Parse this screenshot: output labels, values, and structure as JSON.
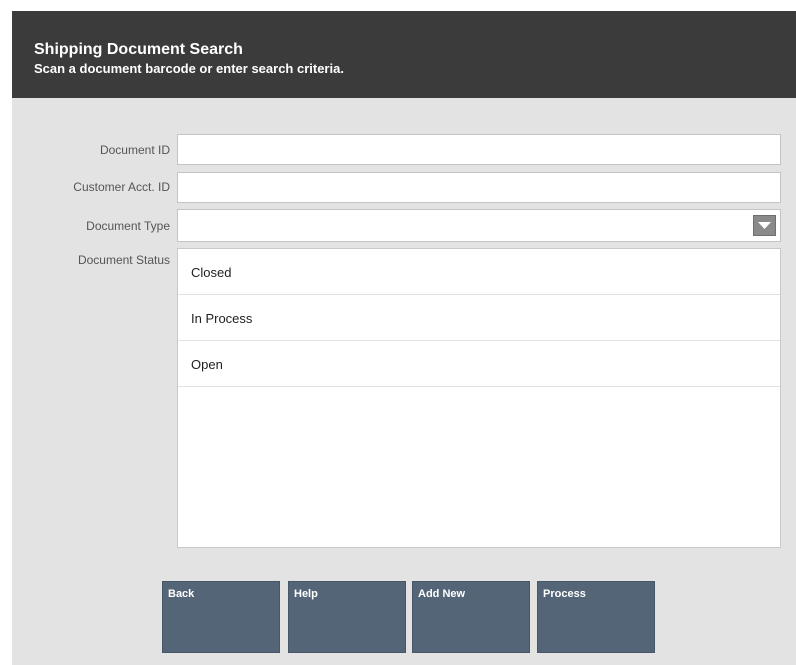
{
  "header": {
    "title": "Shipping Document Search",
    "subtitle": "Scan a document barcode or enter search criteria."
  },
  "form": {
    "document_id": {
      "label": "Document ID",
      "value": ""
    },
    "customer_acct_id": {
      "label": "Customer Acct. ID",
      "value": ""
    },
    "document_type": {
      "label": "Document Type",
      "value": "",
      "icon": "chevron-down-icon"
    },
    "document_status": {
      "label": "Document Status",
      "options": [
        "Closed",
        "In Process",
        "Open"
      ]
    }
  },
  "buttons": {
    "back": "Back",
    "help": "Help",
    "add_new": "Add New",
    "process": "Process"
  },
  "colors": {
    "header_bg": "#3b3b3b",
    "panel_bg": "#e3e3e3",
    "button_bg": "#546578"
  }
}
